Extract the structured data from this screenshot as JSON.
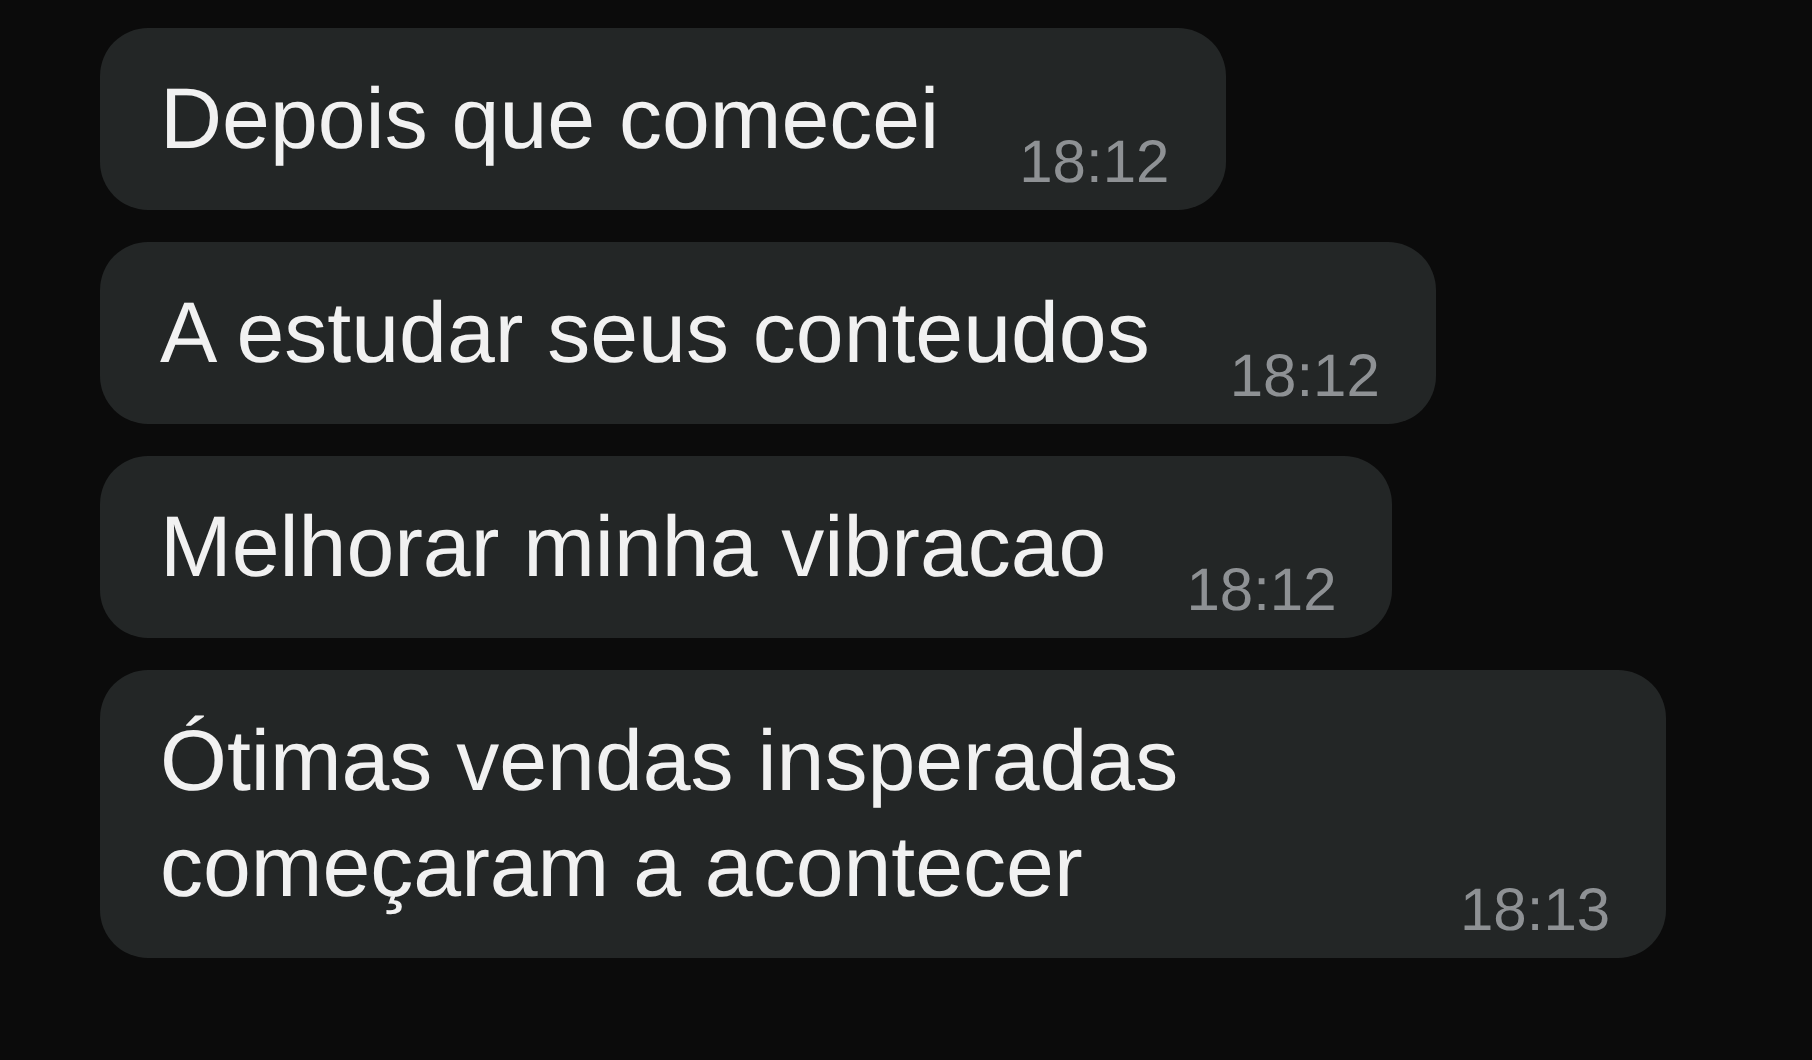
{
  "messages": [
    {
      "text": "Depois que comecei",
      "time": "18:12"
    },
    {
      "text": "A estudar seus conteudos",
      "time": "18:12"
    },
    {
      "text": "Melhorar minha vibracao",
      "time": "18:12"
    },
    {
      "text": "Ótimas vendas insperadas começaram a acontecer",
      "time": "18:13"
    }
  ]
}
